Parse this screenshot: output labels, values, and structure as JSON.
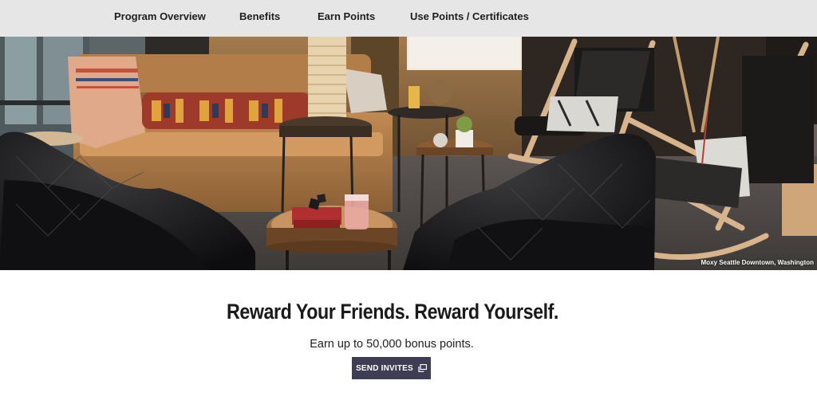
{
  "nav": {
    "items": [
      {
        "label": "Program Overview"
      },
      {
        "label": "Benefits"
      },
      {
        "label": "Earn Points"
      },
      {
        "label": "Use Points / Certificates"
      }
    ]
  },
  "hero": {
    "caption": "Moxy Seattle Downtown, Washington"
  },
  "promo": {
    "headline": "Reward Your Friends. Reward Yourself.",
    "subline": "Earn up to 50,000 bonus points.",
    "button_label": "SEND INVITES",
    "button_icon": "external-window-icon",
    "button_color": "#3f3d56"
  }
}
